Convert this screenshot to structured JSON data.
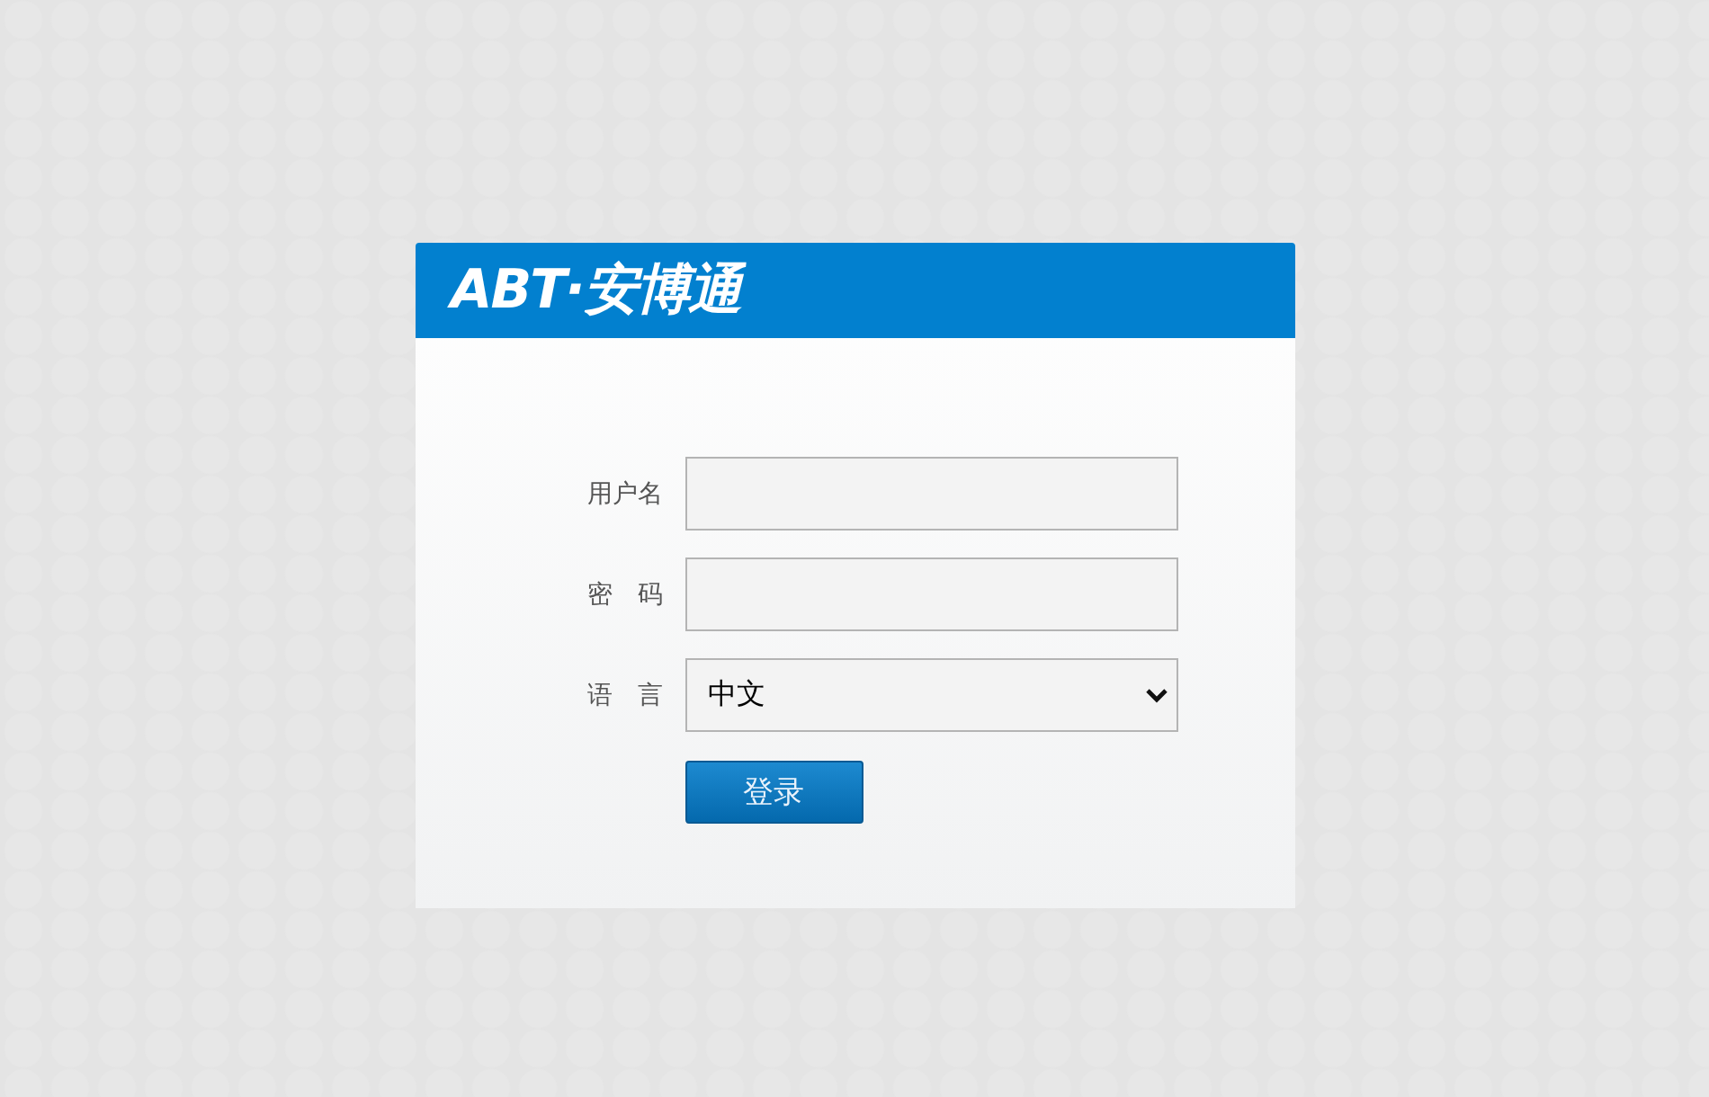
{
  "logo": {
    "text": "ABT·安博通"
  },
  "fields": [
    {
      "kind": "text",
      "label": "用户名"
    },
    {
      "kind": "password",
      "label": "密　码"
    },
    {
      "kind": "select",
      "label": "语　言",
      "value": "中文"
    }
  ],
  "login_button": {
    "label": "登录"
  }
}
